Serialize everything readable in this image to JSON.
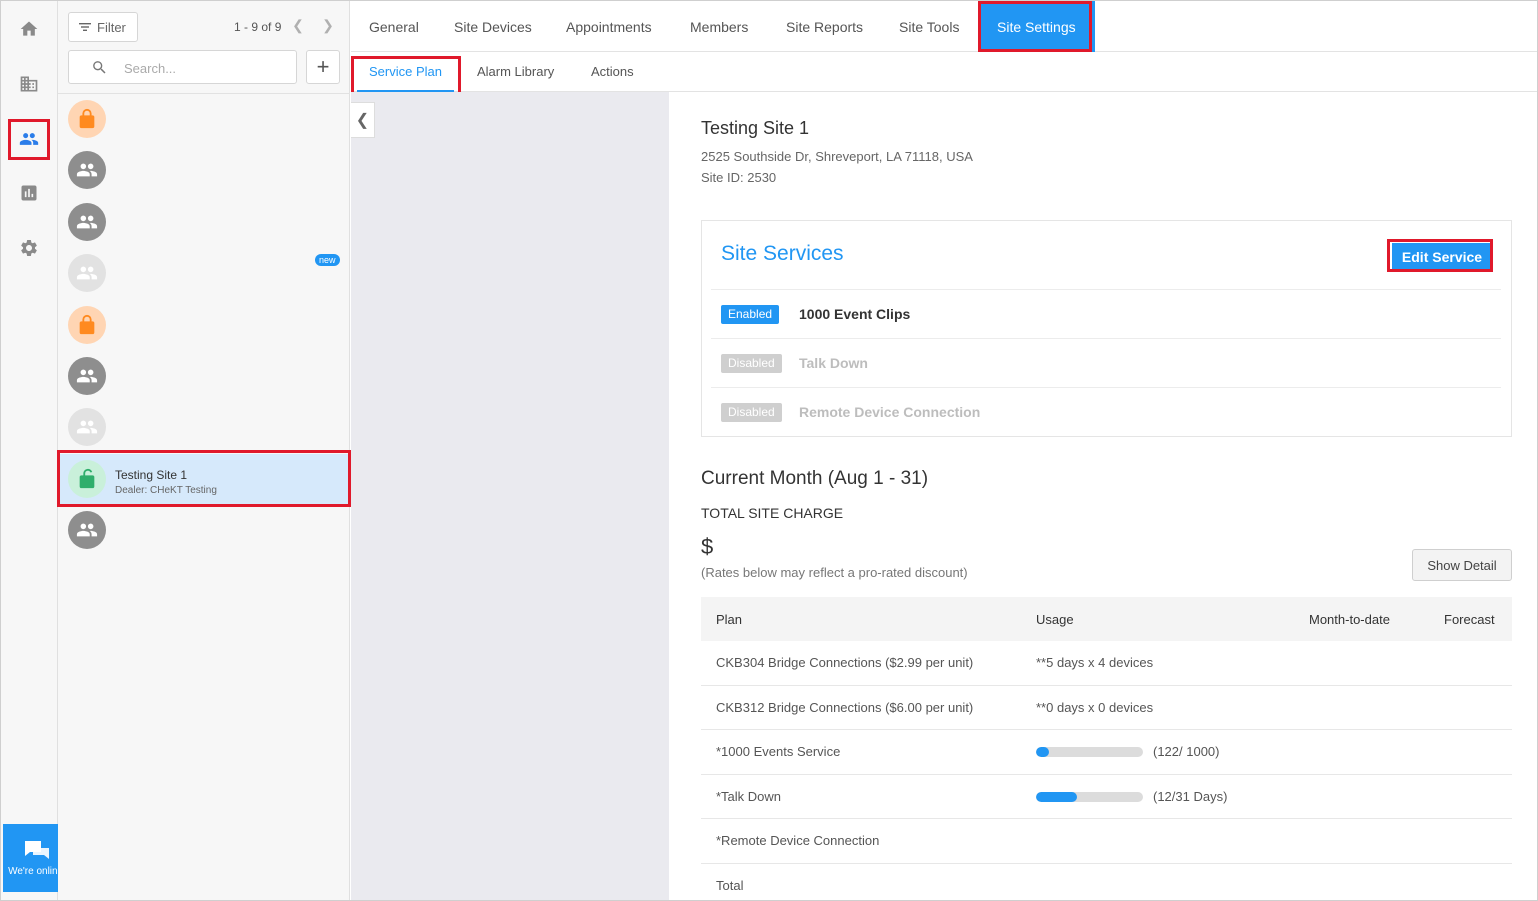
{
  "rail": {
    "items": [
      "home",
      "sites",
      "users",
      "reports",
      "settings"
    ],
    "active": "users"
  },
  "chat": {
    "label": "We're online."
  },
  "list": {
    "filter_label": "Filter",
    "pager": "1 - 9 of 9",
    "search_placeholder": "Search...",
    "add_label": "+",
    "items": [
      {
        "type": "lock",
        "name": "",
        "dealer": "",
        "badge": ""
      },
      {
        "type": "group",
        "name": "",
        "dealer": "",
        "badge": ""
      },
      {
        "type": "group",
        "name": "",
        "dealer": "",
        "badge": ""
      },
      {
        "type": "group-light",
        "name": "",
        "dealer": "",
        "badge": "new"
      },
      {
        "type": "lock",
        "name": "",
        "dealer": "",
        "badge": ""
      },
      {
        "type": "group",
        "name": "",
        "dealer": "",
        "badge": ""
      },
      {
        "type": "group-light",
        "name": "",
        "dealer": "",
        "badge": ""
      },
      {
        "type": "unlock-green",
        "name": "Testing Site 1",
        "dealer": "Dealer: CHeKT Testing",
        "badge": ""
      },
      {
        "type": "group",
        "name": "",
        "dealer": "",
        "badge": ""
      }
    ]
  },
  "tabs": {
    "top": [
      "General",
      "Site Devices",
      "Appointments",
      "Members",
      "Site Reports",
      "Site Tools",
      "Site Settings"
    ],
    "top_active": "Site Settings",
    "sub": [
      "Service Plan",
      "Alarm Library",
      "Actions"
    ],
    "sub_active": "Service Plan"
  },
  "site": {
    "title": "Testing Site 1",
    "address": "2525 Southside Dr, Shreveport, LA 71118, USA",
    "site_id": "Site ID: 2530"
  },
  "services": {
    "title": "Site Services",
    "edit_label": "Edit Service",
    "items": [
      {
        "status": "Enabled",
        "name": "1000 Event Clips"
      },
      {
        "status": "Disabled",
        "name": "Talk Down"
      },
      {
        "status": "Disabled",
        "name": "Remote Device Connection"
      }
    ]
  },
  "billing": {
    "month_title": "Current Month (Aug 1 - 31)",
    "charge_label": "TOTAL SITE CHARGE",
    "charge_value": "$",
    "rates_note": "(Rates below may reflect a pro-rated discount)",
    "show_detail_label": "Show Detail",
    "columns": [
      "Plan",
      "Usage",
      "Month-to-date",
      "Forecast"
    ],
    "rows": [
      {
        "plan": "CKB304 Bridge Connections ($2.99 per unit)",
        "usage": "**5 days x 4 devices",
        "bar": null
      },
      {
        "plan": "CKB312 Bridge Connections ($6.00 per unit)",
        "usage": "**0 days x 0 devices",
        "bar": null
      },
      {
        "plan": "*1000 Events Service",
        "usage": "(122/ 1000)",
        "bar": 0.122
      },
      {
        "plan": "*Talk Down",
        "usage": "(12/31 Days)",
        "bar": 0.387
      },
      {
        "plan": "*Remote Device Connection",
        "usage": "",
        "bar": null
      },
      {
        "plan": "Total",
        "usage": "",
        "bar": null
      }
    ]
  }
}
